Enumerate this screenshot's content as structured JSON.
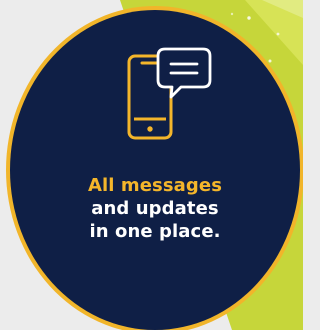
{
  "headline": {
    "line_1": "All messages",
    "line_2": "and updates",
    "line_3": "in one place."
  },
  "icons": {
    "phone": "smartphone-icon",
    "message": "message-bubble-icon"
  },
  "colors": {
    "accent": "#f4b62b",
    "badge_bg": "#0f1f46",
    "text_light": "#ffffff",
    "green_panel": "#c6d63a",
    "outer_bg": "#ececec"
  }
}
